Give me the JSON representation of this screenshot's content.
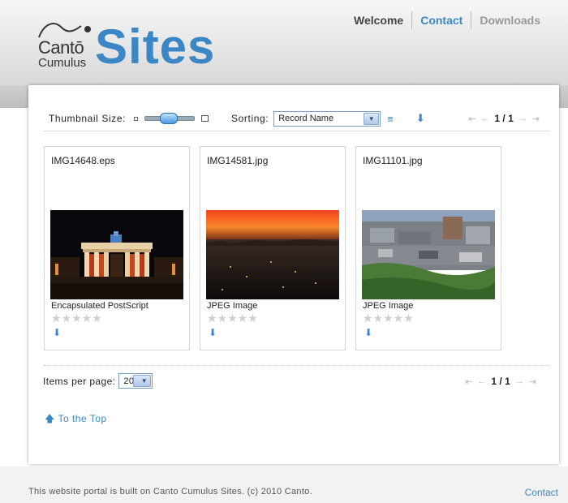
{
  "logo": {
    "canto": "Cantō",
    "cumulus": "Cumulus",
    "sites": "Sites"
  },
  "nav": {
    "welcome": "Welcome",
    "contact": "Contact",
    "downloads": "Downloads"
  },
  "toolbar": {
    "thumbnail_label": "Thumbnail Size:",
    "sorting_label": "Sorting:",
    "sorting_value": "Record Name",
    "page": "1 / 1"
  },
  "records": [
    {
      "filename": "IMG14648.eps",
      "type": "Encapsulated PostScript",
      "rating": 0
    },
    {
      "filename": "IMG14581.jpg",
      "type": "JPEG Image",
      "rating": 0
    },
    {
      "filename": "IMG11101.jpg",
      "type": "JPEG Image",
      "rating": 0
    }
  ],
  "bottom": {
    "items_per_page_label": "Items per page:",
    "items_per_page_value": "20",
    "page": "1 / 1",
    "to_top": "To the Top"
  },
  "footer": {
    "text": "This website portal is built on Canto Cumulus Sites. (c) 2010 Canto.",
    "contact": "Contact"
  },
  "colors": {
    "accent": "#3b87c6"
  },
  "icons": [
    "download-icon",
    "sort-order-icon",
    "first-page-icon",
    "prev-page-icon",
    "next-page-icon",
    "last-page-icon",
    "arrow-up-icon"
  ]
}
